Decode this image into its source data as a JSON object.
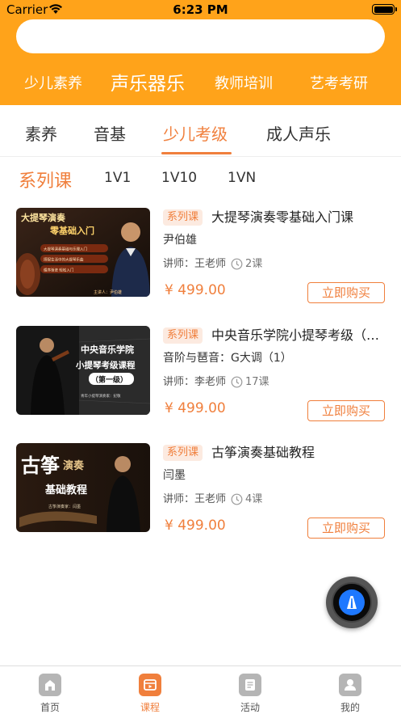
{
  "status_bar": {
    "carrier": "Carrier",
    "time": "6:23 PM"
  },
  "search": {
    "placeholder": ""
  },
  "categories": [
    {
      "label": "少儿素养"
    },
    {
      "label": "声乐器乐"
    },
    {
      "label": "教师培训"
    },
    {
      "label": "艺考考研"
    }
  ],
  "tabs": [
    {
      "label": "素养"
    },
    {
      "label": "音基"
    },
    {
      "label": "少儿考级"
    },
    {
      "label": "成人声乐"
    }
  ],
  "subtabs": [
    {
      "label": "系列课"
    },
    {
      "label": "1V1"
    },
    {
      "label": "1V10"
    },
    {
      "label": "1VN"
    }
  ],
  "courses": [
    {
      "tag": "系列课",
      "title": "大提琴演奏零基础入门课",
      "subtitle": "尹伯雄",
      "teacher": "讲师：王老师",
      "lessons": "2课",
      "price": "¥ 499.00",
      "buy_label": "立即购买",
      "thumb": {
        "line1": "大提琴演奏",
        "line2": "零基础入门",
        "pill1": "大提琴演奏基础与乐理入门",
        "pill2": "搭配生活中的大提琴乐曲",
        "pill3": "循序渐进 轻松入门",
        "presenter": "主讲人：尹伯雄"
      }
    },
    {
      "tag": "系列课",
      "title": "中央音乐学院小提琴考级（第一级）",
      "subtitle": "音阶与琶音：G大调（1）",
      "teacher": "讲师：李老师",
      "lessons": "17课",
      "price": "¥ 499.00",
      "buy_label": "立即购买",
      "thumb": {
        "line1": "中央音乐学院",
        "line2": "小提琴考级课程",
        "line3": "（第一级）",
        "presenter": "青年小提琴演奏家：纪敬"
      }
    },
    {
      "tag": "系列课",
      "title": "古筝演奏基础教程",
      "subtitle": "闫墨",
      "teacher": "讲师：王老师",
      "lessons": "4课",
      "price": "¥ 499.00",
      "buy_label": "立即购买",
      "thumb": {
        "line1": "古筝",
        "line1b": "演奏",
        "line2": "基础教程",
        "presenter": "古筝演奏家：闫墨"
      }
    }
  ],
  "tabbar": [
    {
      "label": "首页",
      "icon": "home-icon"
    },
    {
      "label": "课程",
      "icon": "course-icon"
    },
    {
      "label": "活动",
      "icon": "activity-icon"
    },
    {
      "label": "我的",
      "icon": "profile-icon"
    }
  ],
  "colors": {
    "brand": "#FFA31A",
    "accent": "#F07F3C",
    "tag_bg": "#FCEAE0"
  }
}
